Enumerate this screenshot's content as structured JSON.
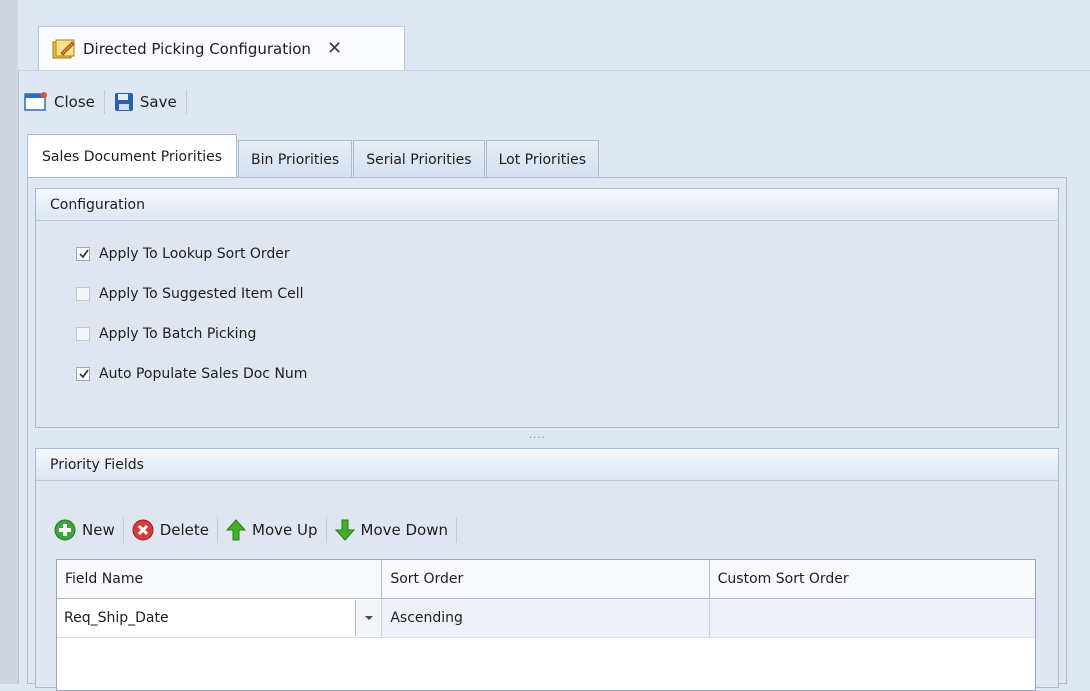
{
  "document_tab": {
    "title": "Directed Picking Configuration",
    "close_glyph": "✕"
  },
  "toolbar": {
    "close_label": "Close",
    "save_label": "Save"
  },
  "tabs": [
    {
      "label": "Sales Document Priorities",
      "active": true
    },
    {
      "label": "Bin Priorities",
      "active": false
    },
    {
      "label": "Serial Priorities",
      "active": false
    },
    {
      "label": "Lot Priorities",
      "active": false
    }
  ],
  "configuration": {
    "title": "Configuration",
    "options": [
      {
        "label": "Apply To Lookup Sort Order",
        "checked": true,
        "enabled": true
      },
      {
        "label": "Apply To Suggested Item Cell",
        "checked": false,
        "enabled": false
      },
      {
        "label": "Apply To Batch Picking",
        "checked": false,
        "enabled": false
      },
      {
        "label": "Auto Populate Sales Doc Num",
        "checked": true,
        "enabled": true
      }
    ]
  },
  "splitter": "....",
  "priority_fields": {
    "title": "Priority Fields",
    "toolbar": {
      "new_label": "New",
      "delete_label": "Delete",
      "move_up_label": "Move Up",
      "move_down_label": "Move Down"
    },
    "columns": [
      "Field Name",
      "Sort Order",
      "Custom Sort Order"
    ],
    "rows": [
      {
        "field_name": "Req_Ship_Date",
        "sort_order": "Ascending",
        "custom_sort_order": ""
      }
    ]
  },
  "colors": {
    "new_green": "#3aa83a",
    "delete_red": "#d93a3a",
    "move_green": "#43b02a",
    "save_blue": "#2a5fb0"
  }
}
